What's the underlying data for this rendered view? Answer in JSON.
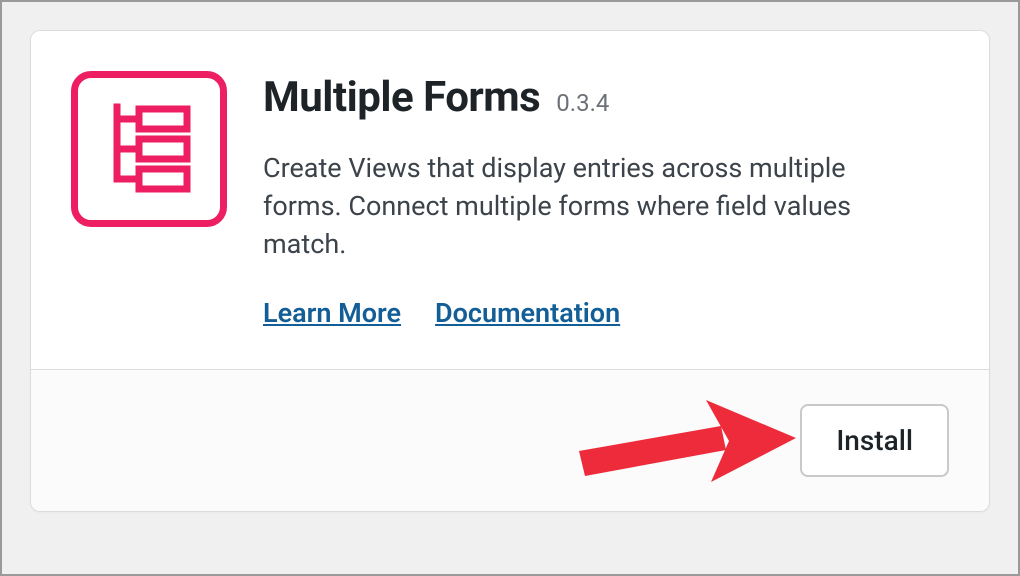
{
  "plugin": {
    "title": "Multiple Forms",
    "version": "0.3.4",
    "description": "Create Views that display entries across multiple forms. Connect multiple forms where field values match.",
    "icon_color": "#ed1e62",
    "links": {
      "learn_more": "Learn More",
      "documentation": "Documentation"
    },
    "install_label": "Install"
  }
}
